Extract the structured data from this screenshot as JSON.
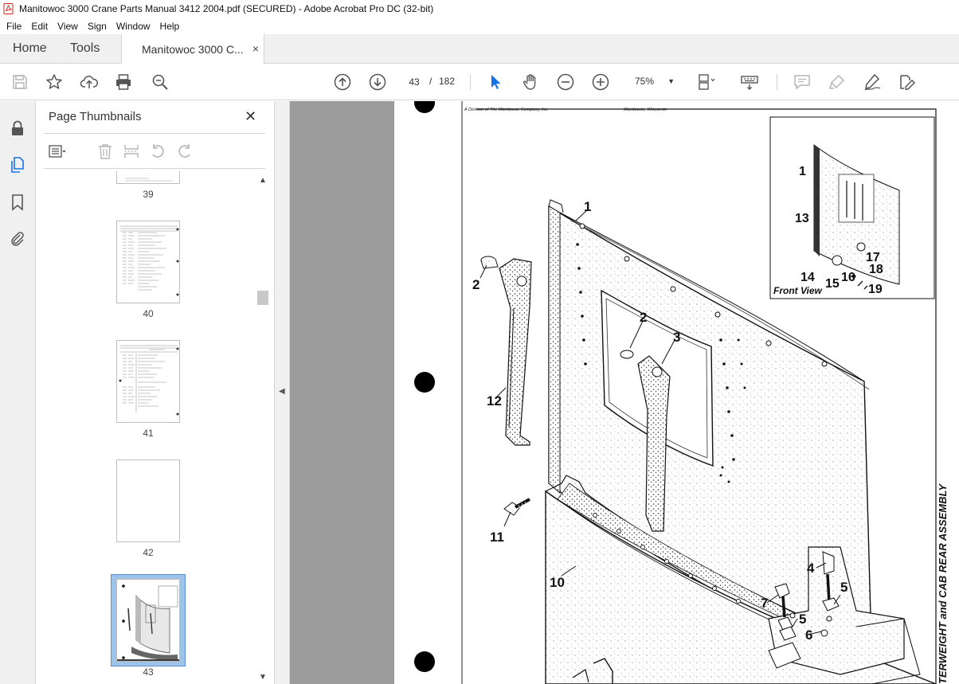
{
  "window": {
    "title": "Manitowoc 3000 Crane Parts Manual 3412 2004.pdf (SECURED) - Adobe Acrobat Pro DC (32-bit)"
  },
  "menu": [
    "File",
    "Edit",
    "View",
    "Sign",
    "Window",
    "Help"
  ],
  "tabs": {
    "home": "Home",
    "tools": "Tools",
    "document": "Manitowoc 3000 C...",
    "close": "×"
  },
  "toolbar": {
    "current_page": "43",
    "separator": "/",
    "total_pages": "182",
    "zoom": "75%",
    "icons": [
      "save-icon",
      "star-icon",
      "upload-icon",
      "print-icon",
      "search-zoom-icon",
      "arrow-up-icon",
      "arrow-down-icon",
      "select-arrow-icon",
      "hand-icon",
      "zoom-out-icon",
      "zoom-in-icon",
      "page-fit-icon",
      "keyboard-icon",
      "comment-icon",
      "highlight-icon",
      "sign-icon",
      "edit-icon"
    ]
  },
  "panel": {
    "title": "Page Thumbnails",
    "close": "✕",
    "thumbnails": [
      {
        "label": "39"
      },
      {
        "label": "40"
      },
      {
        "label": "41"
      },
      {
        "label": "42"
      },
      {
        "label": "43",
        "selected": true
      }
    ]
  },
  "page": {
    "header_left": "A Division of The Manitowoc Company, Inc.",
    "header_right": "Manitowoc, Wisconsin",
    "inset_caption": "Front View",
    "side_title": "COUNTERWEIGHT and CAB REAR ASSEMBLY",
    "side_title_visible": "TERWEIGHT and CAB REAR ASSEMBLY",
    "callouts": [
      "1",
      "2",
      "3",
      "4",
      "5",
      "5",
      "6",
      "7",
      "10",
      "11",
      "12",
      "2"
    ],
    "inset_callouts": [
      "1",
      "13",
      "14",
      "15",
      "16",
      "17",
      "18",
      "19"
    ]
  },
  "colors": {
    "accent": "#1473e6",
    "chrome_bg": "#f0f0f0",
    "viewer_bg": "#9b9b9b",
    "thumb_selected": "#9ec3e8",
    "acrobat_red": "#d9251c"
  }
}
